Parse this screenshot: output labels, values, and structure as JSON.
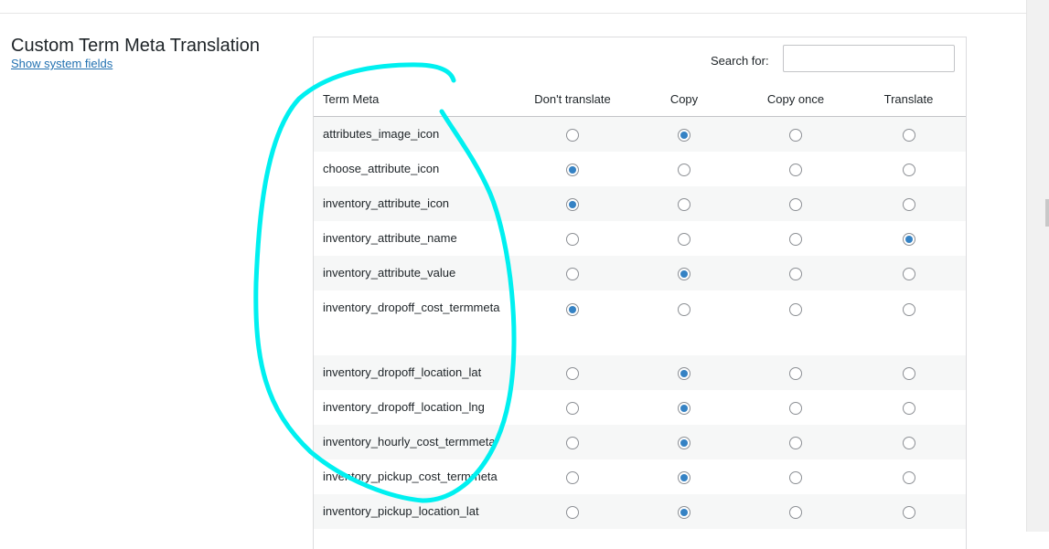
{
  "section": {
    "title": "Custom Term Meta Translation",
    "system_fields_link": "Show system fields"
  },
  "search": {
    "label": "Search for:",
    "value": ""
  },
  "table": {
    "columns": [
      "Term Meta",
      "Don't translate",
      "Copy",
      "Copy once",
      "Translate"
    ],
    "rows": [
      {
        "term": "attributes_image_icon",
        "selected": "Copy"
      },
      {
        "term": "choose_attribute_icon",
        "selected": "Don't translate"
      },
      {
        "term": "inventory_attribute_icon",
        "selected": "Don't translate"
      },
      {
        "term": "inventory_attribute_name",
        "selected": "Translate"
      },
      {
        "term": "inventory_attribute_value",
        "selected": "Copy"
      },
      {
        "term": "inventory_dropoff_cost_termmeta",
        "selected": "Don't translate"
      },
      {
        "term": "inventory_dropoff_location_lat",
        "selected": "Copy"
      },
      {
        "term": "inventory_dropoff_location_lng",
        "selected": "Copy"
      },
      {
        "term": "inventory_hourly_cost_termmeta",
        "selected": "Copy"
      },
      {
        "term": "inventory_pickup_cost_termmeta",
        "selected": "Copy"
      },
      {
        "term": "inventory_pickup_location_lat",
        "selected": "Copy"
      }
    ]
  },
  "colors": {
    "accent": "#3582c4",
    "link": "#2271b1",
    "annotation": "#00f0f0"
  }
}
